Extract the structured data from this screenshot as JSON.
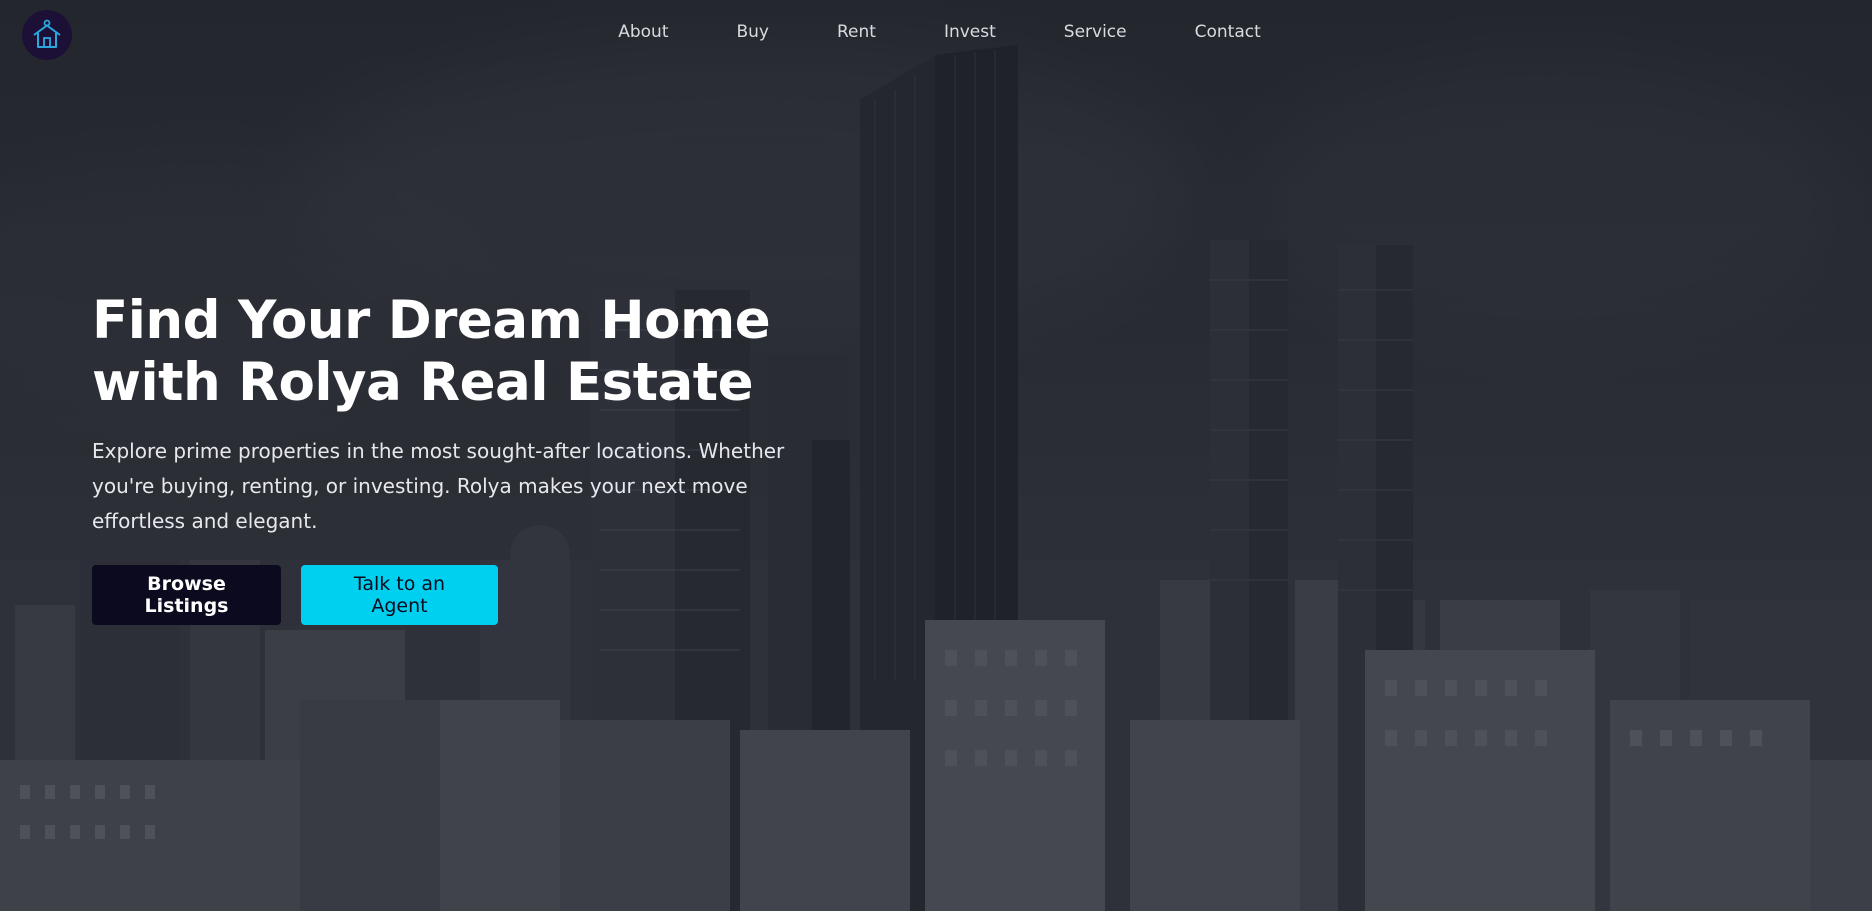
{
  "brand": {
    "logo_icon": "house-icon",
    "logo_bg": "#1c1036",
    "logo_stroke": "#2aa8e0"
  },
  "nav": {
    "items": [
      {
        "label": "About"
      },
      {
        "label": "Buy"
      },
      {
        "label": "Rent"
      },
      {
        "label": "Invest"
      },
      {
        "label": "Service"
      },
      {
        "label": "Contact"
      }
    ]
  },
  "hero": {
    "headline_line1": "Find Your Dream Home",
    "headline_line2": "with Rolya Real Estate",
    "subtext": "Explore prime properties in the most sought-after locations. Whether you're buying, renting, or investing. Rolya makes your next move effortless and elegant.",
    "primary_button": "Browse Listings",
    "secondary_button": "Talk to an Agent"
  },
  "colors": {
    "primary_button_bg": "#0b0a1e",
    "secondary_button_bg": "#00d0f0",
    "text": "#ffffff"
  }
}
